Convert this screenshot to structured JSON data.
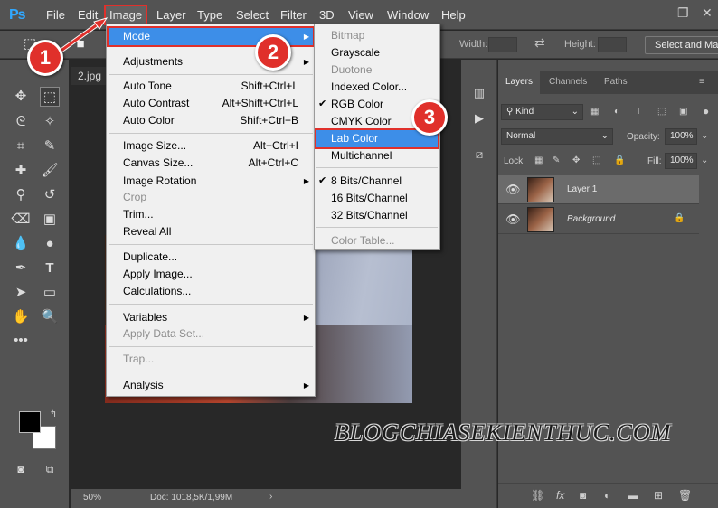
{
  "app": {
    "logo": "Ps"
  },
  "menubar": {
    "items": [
      "File",
      "Edit",
      "Image",
      "Layer",
      "Type",
      "Select",
      "Filter",
      "3D",
      "View",
      "Window",
      "Help"
    ]
  },
  "options": {
    "width_label": "Width:",
    "height_label": "Height:",
    "button": "Select and Ma"
  },
  "document": {
    "tab": "2.jpg",
    "zoom": "50%",
    "doc_info": "Doc: 1018,5K/1,99M"
  },
  "image_menu": {
    "mode": "Mode",
    "adjustments": "Adjustments",
    "auto_tone": "Auto Tone",
    "auto_tone_sc": "Shift+Ctrl+L",
    "auto_contrast": "Auto Contrast",
    "auto_contrast_sc": "Alt+Shift+Ctrl+L",
    "auto_color": "Auto Color",
    "auto_color_sc": "Shift+Ctrl+B",
    "image_size": "Image Size...",
    "image_size_sc": "Alt+Ctrl+I",
    "canvas_size": "Canvas Size...",
    "canvas_size_sc": "Alt+Ctrl+C",
    "image_rotation": "Image Rotation",
    "crop": "Crop",
    "trim": "Trim...",
    "reveal_all": "Reveal All",
    "duplicate": "Duplicate...",
    "apply_image": "Apply Image...",
    "calculations": "Calculations...",
    "variables": "Variables",
    "apply_data_set": "Apply Data Set...",
    "trap": "Trap...",
    "analysis": "Analysis"
  },
  "mode_menu": {
    "bitmap": "Bitmap",
    "grayscale": "Grayscale",
    "duotone": "Duotone",
    "indexed": "Indexed Color...",
    "rgb": "RGB Color",
    "cmyk": "CMYK Color",
    "lab": "Lab Color",
    "multichannel": "Multichannel",
    "bits8": "8 Bits/Channel",
    "bits16": "16 Bits/Channel",
    "bits32": "32 Bits/Channel",
    "color_table": "Color Table..."
  },
  "layers_panel": {
    "tabs": [
      "Layers",
      "Channels",
      "Paths"
    ],
    "kind": "Kind",
    "blend": "Normal",
    "opacity_label": "Opacity:",
    "opacity": "100%",
    "lock_label": "Lock:",
    "fill_label": "Fill:",
    "fill": "100%",
    "layers": [
      "Layer 1",
      "Background"
    ]
  },
  "annotations": {
    "b1": "1",
    "b2": "2",
    "b3": "3"
  },
  "watermark": "BLOGCHIASEKIENTHUC.COM",
  "colors": {
    "highlight": "#3d8ee8",
    "annotation_red": "#e0302b",
    "ps_blue": "#31a8ff"
  }
}
